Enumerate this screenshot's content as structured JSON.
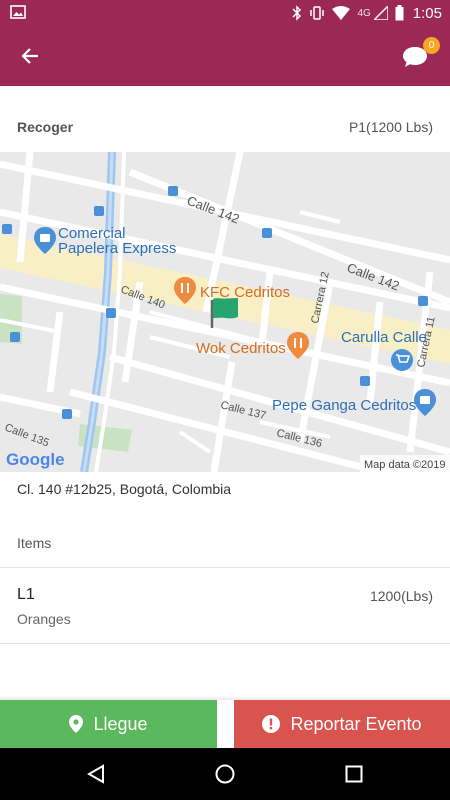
{
  "status_bar": {
    "network": "4G",
    "time": "1:05"
  },
  "app_bar": {
    "back_icon": "arrow-left-icon",
    "chat_icon": "chat-bubble-icon",
    "chat_badge": "0",
    "color": "#9c2955"
  },
  "pickup": {
    "label": "Recoger",
    "value": "P1(1200 Lbs)"
  },
  "map": {
    "labels": {
      "calle142_a": "Calle 142",
      "calle142_b": "Calle 142",
      "calle140": "Calle 140",
      "calle137": "Calle 137",
      "calle136": "Calle 136",
      "calle135": "Calle 135",
      "carrera12": "Carrera 12",
      "carrera11": "Carrera 11",
      "comercial1": "Comercial",
      "comercial2": "Papelera Express",
      "kfc": "KFC Cedritos",
      "wok": "Wok Cedritos",
      "carulla": "Carulla Calle",
      "pepe": "Pepe Ganga Cedritos",
      "google": "Google",
      "mapdata": "Map data ©2019"
    }
  },
  "address": "Cl. 140 #12b25, Bogotá, Colombia",
  "items": {
    "header": "Items",
    "rows": [
      {
        "code": "L1",
        "description": "Oranges",
        "quantity": "1200(Lbs)"
      }
    ]
  },
  "actions": {
    "llegue": {
      "label": "Llegue",
      "icon": "map-marker-icon",
      "color": "#5cb85c"
    },
    "reportar": {
      "label": "Reportar Evento",
      "icon": "exclamation-circle-icon",
      "color": "#d9534f"
    }
  }
}
